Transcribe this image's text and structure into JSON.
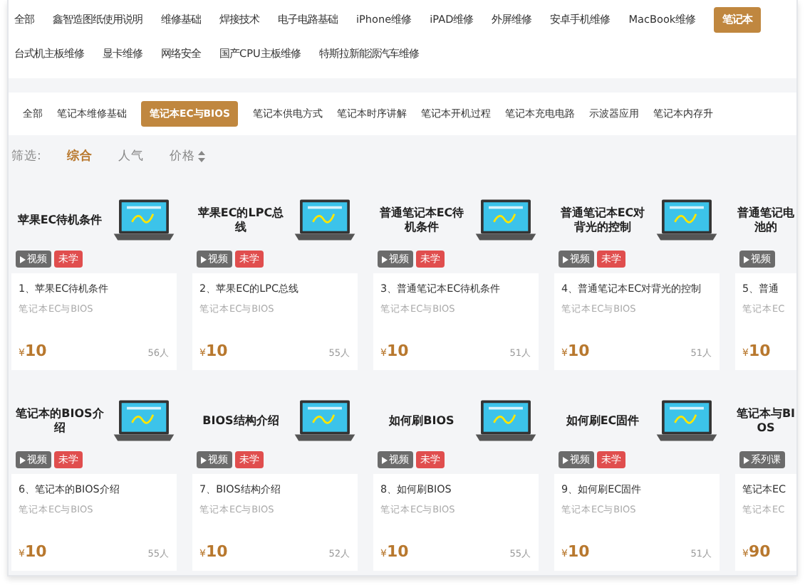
{
  "top_category_rows": [
    [
      {
        "label": "全部",
        "selected": false
      },
      {
        "label": "鑫智造图纸使用说明",
        "selected": false
      },
      {
        "label": "维修基础",
        "selected": false
      },
      {
        "label": "焊接技术",
        "selected": false
      },
      {
        "label": "电子电路基础",
        "selected": false
      },
      {
        "label": "iPhone维修",
        "selected": false
      },
      {
        "label": "iPAD维修",
        "selected": false
      },
      {
        "label": "外屏维修",
        "selected": false
      },
      {
        "label": "安卓手机维修",
        "selected": false
      },
      {
        "label": "MacBook维修",
        "selected": false
      },
      {
        "label": "笔记本",
        "selected": true
      }
    ],
    [
      {
        "label": "台式机主板维修",
        "selected": false
      },
      {
        "label": "显卡维修",
        "selected": false
      },
      {
        "label": "网络安全",
        "selected": false
      },
      {
        "label": "国产CPU主板维修",
        "selected": false
      },
      {
        "label": "特斯拉新能源汽车维修",
        "selected": false
      }
    ]
  ],
  "sub_categories": [
    {
      "label": "全部",
      "selected": false
    },
    {
      "label": "笔记本维修基础",
      "selected": false
    },
    {
      "label": "笔记本EC与BIOS",
      "selected": true
    },
    {
      "label": "笔记本供电方式",
      "selected": false
    },
    {
      "label": "笔记本时序讲解",
      "selected": false
    },
    {
      "label": "笔记本开机过程",
      "selected": false
    },
    {
      "label": "笔记本充电电路",
      "selected": false
    },
    {
      "label": "示波器应用",
      "selected": false
    },
    {
      "label": "笔记本内存升",
      "selected": false
    }
  ],
  "filter": {
    "label": "筛选:",
    "options": [
      {
        "label": "综合",
        "selected": true,
        "sortable": false
      },
      {
        "label": "人气",
        "selected": false,
        "sortable": false
      },
      {
        "label": "价格",
        "selected": false,
        "sortable": true
      }
    ]
  },
  "course_rows": [
    [
      {
        "cover_title": "苹果EC待机条件",
        "has_thumbnail": true,
        "tags": [
          {
            "kind": "video",
            "label": "视频"
          },
          {
            "kind": "status",
            "label": "未学"
          }
        ],
        "title": "1、苹果EC待机条件",
        "category": "笔记本EC与BIOS",
        "currency": "¥",
        "amount": "10",
        "learners": "56人"
      },
      {
        "cover_title": "苹果EC的LPC总线",
        "has_thumbnail": true,
        "tags": [
          {
            "kind": "video",
            "label": "视频"
          },
          {
            "kind": "status",
            "label": "未学"
          }
        ],
        "title": "2、苹果EC的LPC总线",
        "category": "笔记本EC与BIOS",
        "currency": "¥",
        "amount": "10",
        "learners": "55人"
      },
      {
        "cover_title": "普通笔记本EC待机条件",
        "has_thumbnail": true,
        "tags": [
          {
            "kind": "video",
            "label": "视频"
          },
          {
            "kind": "status",
            "label": "未学"
          }
        ],
        "title": "3、普通笔记本EC待机条件",
        "category": "笔记本EC与BIOS",
        "currency": "¥",
        "amount": "10",
        "learners": "51人"
      },
      {
        "cover_title": "普通笔记本EC对背光的控制",
        "has_thumbnail": true,
        "tags": [
          {
            "kind": "video",
            "label": "视频"
          },
          {
            "kind": "status",
            "label": "未学"
          }
        ],
        "title": "4、普通笔记本EC对背光的控制",
        "category": "笔记本EC与BIOS",
        "currency": "¥",
        "amount": "10",
        "learners": "51人"
      },
      {
        "cover_title": "普通笔记电池的",
        "has_thumbnail": false,
        "tags": [
          {
            "kind": "video",
            "label": "视频"
          }
        ],
        "title": "5、普通",
        "category": "笔记本EC",
        "currency": "¥",
        "amount": "10"
      }
    ],
    [
      {
        "cover_title": "笔记本的BIOS介绍",
        "has_thumbnail": true,
        "tags": [
          {
            "kind": "video",
            "label": "视频"
          },
          {
            "kind": "status",
            "label": "未学"
          }
        ],
        "title": "6、笔记本的BIOS介绍",
        "category": "笔记本EC与BIOS",
        "currency": "¥",
        "amount": "10",
        "learners": "55人"
      },
      {
        "cover_title": "BIOS结构介绍",
        "has_thumbnail": true,
        "tags": [
          {
            "kind": "video",
            "label": "视频"
          },
          {
            "kind": "status",
            "label": "未学"
          }
        ],
        "title": "7、BIOS结构介绍",
        "category": "笔记本EC与BIOS",
        "currency": "¥",
        "amount": "10",
        "learners": "52人"
      },
      {
        "cover_title": "如何刷BIOS",
        "has_thumbnail": true,
        "tags": [
          {
            "kind": "video",
            "label": "视频"
          },
          {
            "kind": "status",
            "label": "未学"
          }
        ],
        "title": "8、如何刷BIOS",
        "category": "笔记本EC与BIOS",
        "currency": "¥",
        "amount": "10",
        "learners": "55人"
      },
      {
        "cover_title": "如何刷EC固件",
        "has_thumbnail": true,
        "tags": [
          {
            "kind": "video",
            "label": "视频"
          },
          {
            "kind": "status",
            "label": "未学"
          }
        ],
        "title": "9、如何刷EC固件",
        "category": "笔记本EC与BIOS",
        "currency": "¥",
        "amount": "10",
        "learners": "51人"
      },
      {
        "cover_title": "笔记本与BIOS",
        "has_thumbnail": false,
        "tags": [
          {
            "kind": "series",
            "label": "系列课"
          }
        ],
        "title": "笔记本EC",
        "category": "笔记本EC",
        "currency": "¥",
        "amount": "90"
      }
    ]
  ]
}
